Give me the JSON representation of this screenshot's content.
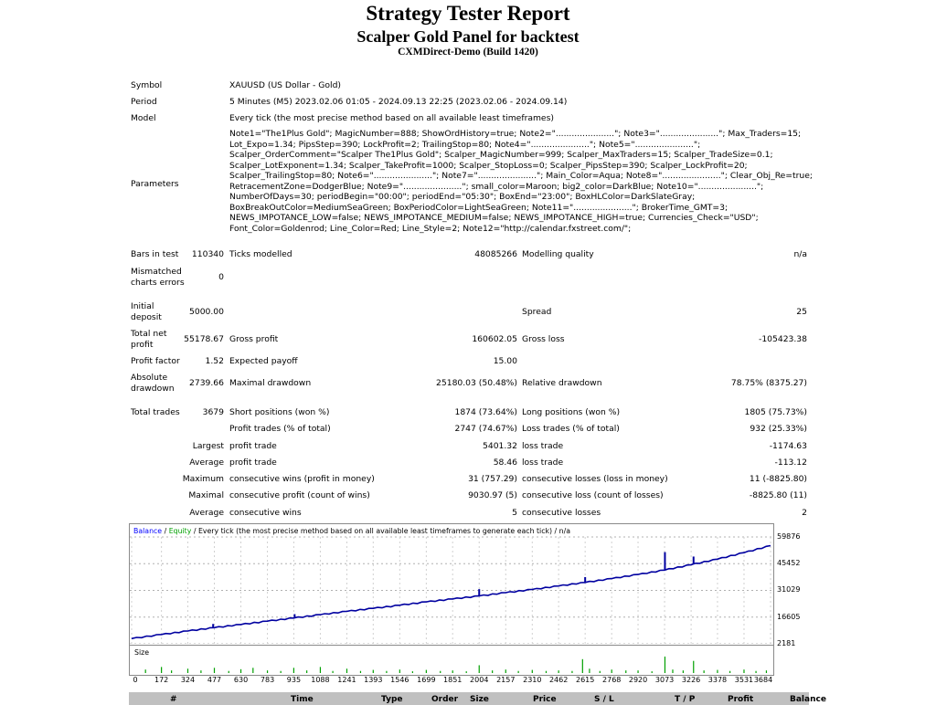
{
  "header": {
    "title": "Strategy Tester Report",
    "subtitle": "Scalper Gold Panel for backtest",
    "server": "CXMDirect-Demo (Build 1420)"
  },
  "info": {
    "symbol_label": "Symbol",
    "symbol_value": "XAUUSD (US Dollar - Gold)",
    "period_label": "Period",
    "period_value": "5 Minutes (M5) 2023.02.06 01:05 - 2024.09.13 22:25 (2023.02.06 - 2024.09.14)",
    "model_label": "Model",
    "model_value": "Every tick (the most precise method based on all available least timeframes)",
    "parameters_label": "Parameters",
    "parameters_value": "Note1=\"The1Plus Gold\"; MagicNumber=888; ShowOrdHistory=true; Note2=\"......................\"; Note3=\"......................\"; Max_Traders=15; Lot_Expo=1.34; PipsStep=390; LockProfit=2; TrailingStop=80; Note4=\"......................\"; Note5=\"......................\"; Scalper_OrderComment=\"Scalper The1Plus Gold\"; Scalper_MagicNumber=999; Scalper_MaxTraders=15; Scalper_TradeSize=0.1; Scalper_LotExponent=1.34; Scalper_TakeProfit=1000; Scalper_StopLoss=0; Scalper_PipsStep=390; Scalper_LockProfit=20; Scalper_TrailingStop=80; Note6=\"......................\"; Note7=\"......................\"; Main_Color=Aqua; Note8=\"......................\"; Clear_Obj_Re=true; RetracementZone=DodgerBlue; Note9=\"......................\"; small_color=Maroon; big2_color=DarkBlue; Note10=\"......................\"; NumberOfDays=30; periodBegin=\"00:00\"; periodEnd=\"05:30\"; BoxEnd=\"23:00\"; BoxHLColor=DarkSlateGray; BoxBreakOutColor=MediumSeaGreen; BoxPeriodColor=LightSeaGreen; Note11=\"......................\"; BrokerTime_GMT=3; NEWS_IMPOTANCE_LOW=false; NEWS_IMPOTANCE_MEDIUM=false; NEWS_IMPOTANCE_HIGH=true; Currencies_Check=\"USD\"; Font_Color=Goldenrod; Line_Color=Red; Line_Style=2; Note12=\"http://calendar.fxstreet.com/\";"
  },
  "stats": {
    "bars_label": "Bars in test",
    "bars_value": "110340",
    "ticks_label": "Ticks modelled",
    "ticks_value": "48085266",
    "quality_label": "Modelling quality",
    "quality_value": "n/a",
    "mismatched_label_1": "Mismatched",
    "mismatched_label_2": "charts errors",
    "mismatched_value": "0",
    "deposit_label_1": "Initial",
    "deposit_label_2": "deposit",
    "deposit_value": "5000.00",
    "spread_label": "Spread",
    "spread_value": "25",
    "net_label_1": "Total net",
    "net_label_2": "profit",
    "net_value": "55178.67",
    "gross_profit_label": "Gross profit",
    "gross_profit_value": "160602.05",
    "gross_loss_label": "Gross loss",
    "gross_loss_value": "-105423.38",
    "pf_label": "Profit factor",
    "pf_value": "1.52",
    "ep_label": "Expected payoff",
    "ep_value": "15.00",
    "abs_dd_label_1": "Absolute",
    "abs_dd_label_2": "drawdown",
    "abs_dd_value": "2739.66",
    "max_dd_label": "Maximal drawdown",
    "max_dd_value": "25180.03 (50.48%)",
    "rel_dd_label": "Relative drawdown",
    "rel_dd_value": "78.75% (8375.27)",
    "trades_label": "Total trades",
    "trades_value": "3679",
    "short_label": "Short positions (won %)",
    "short_value": "1874 (73.64%)",
    "long_label": "Long positions (won %)",
    "long_value": "1805 (75.73%)",
    "profit_trades_label": "Profit trades (% of total)",
    "profit_trades_value": "2747 (74.67%)",
    "loss_trades_label": "Loss trades (% of total)",
    "loss_trades_value": "932 (25.33%)",
    "largest_label": "Largest",
    "largest_pt_label": "profit trade",
    "largest_pt_value": "5401.32",
    "largest_lt_label": "loss trade",
    "largest_lt_value": "-1174.63",
    "average_label": "Average",
    "average_pt_label": "profit trade",
    "average_pt_value": "58.46",
    "average_lt_label": "loss trade",
    "average_lt_value": "-113.12",
    "maximum_label": "Maximum",
    "max_cw_label": "consecutive wins (profit in money)",
    "max_cw_value": "31 (757.29)",
    "max_cl_label": "consecutive losses (loss in money)",
    "max_cl_value": "11 (-8825.80)",
    "maximal_label": "Maximal",
    "maximal_cp_label": "consecutive profit (count of wins)",
    "maximal_cp_value": "9030.97 (5)",
    "maximal_cl_label": "consecutive loss (count of losses)",
    "maximal_cl_value": "-8825.80 (11)",
    "avg2_label": "Average",
    "avg_cw_label": "consecutive wins",
    "avg_cw_value": "5",
    "avg_cl_label": "consecutive losses",
    "avg_cl_value": "2"
  },
  "chart_legend": {
    "balance": "Balance",
    "sep": " / ",
    "equity": "Equity",
    "rest": " / Every tick (the most precise method based on all available least timeframes to generate each tick) / n/a",
    "balance_color": "#0000ff",
    "equity_color": "#00a000",
    "size_label": "Size"
  },
  "chart_data": {
    "type": "line",
    "title": "",
    "xlabel": "",
    "ylabel": "",
    "y_ticks": [
      "59876",
      "45452",
      "31029",
      "16605",
      "2181"
    ],
    "x_ticks": [
      "0",
      "172",
      "324",
      "477",
      "630",
      "783",
      "935",
      "1088",
      "1241",
      "1393",
      "1546",
      "1699",
      "1851",
      "2004",
      "2157",
      "2310",
      "2462",
      "2615",
      "2768",
      "2920",
      "3073",
      "3226",
      "3378",
      "3531",
      "3684"
    ],
    "ylim": [
      2181,
      59876
    ],
    "xlim": [
      0,
      3684
    ],
    "series": [
      {
        "name": "Balance",
        "color": "#0000a0",
        "x": [
          0,
          172,
          324,
          477,
          630,
          783,
          935,
          1088,
          1241,
          1393,
          1546,
          1699,
          1851,
          2004,
          2157,
          2310,
          2462,
          2615,
          2768,
          2920,
          3073,
          3226,
          3378,
          3531,
          3684
        ],
        "y": [
          5000,
          7200,
          9100,
          10900,
          12600,
          14400,
          16100,
          17900,
          19700,
          21300,
          23000,
          24800,
          26400,
          28000,
          29800,
          31500,
          33400,
          35300,
          37400,
          39600,
          42000,
          44900,
          47900,
          51400,
          55178
        ]
      }
    ],
    "spikes": [
      {
        "x": 260,
        "y": 8200
      },
      {
        "x": 470,
        "y": 12900
      },
      {
        "x": 940,
        "y": 18200
      },
      {
        "x": 2004,
        "y": 31700
      },
      {
        "x": 2615,
        "y": 38200
      },
      {
        "x": 3075,
        "y": 51700
      },
      {
        "x": 3240,
        "y": 49300
      }
    ],
    "size_bars": [
      {
        "x": 80,
        "v": 0.2
      },
      {
        "x": 172,
        "v": 0.35
      },
      {
        "x": 230,
        "v": 0.15
      },
      {
        "x": 324,
        "v": 0.25
      },
      {
        "x": 400,
        "v": 0.15
      },
      {
        "x": 477,
        "v": 0.3
      },
      {
        "x": 560,
        "v": 0.12
      },
      {
        "x": 630,
        "v": 0.22
      },
      {
        "x": 700,
        "v": 0.3
      },
      {
        "x": 783,
        "v": 0.15
      },
      {
        "x": 860,
        "v": 0.12
      },
      {
        "x": 935,
        "v": 0.3
      },
      {
        "x": 1010,
        "v": 0.15
      },
      {
        "x": 1088,
        "v": 0.35
      },
      {
        "x": 1160,
        "v": 0.12
      },
      {
        "x": 1241,
        "v": 0.25
      },
      {
        "x": 1320,
        "v": 0.12
      },
      {
        "x": 1393,
        "v": 0.18
      },
      {
        "x": 1470,
        "v": 0.12
      },
      {
        "x": 1546,
        "v": 0.2
      },
      {
        "x": 1620,
        "v": 0.1
      },
      {
        "x": 1699,
        "v": 0.18
      },
      {
        "x": 1780,
        "v": 0.12
      },
      {
        "x": 1851,
        "v": 0.15
      },
      {
        "x": 1930,
        "v": 0.1
      },
      {
        "x": 2004,
        "v": 0.45
      },
      {
        "x": 2080,
        "v": 0.15
      },
      {
        "x": 2157,
        "v": 0.2
      },
      {
        "x": 2230,
        "v": 0.12
      },
      {
        "x": 2310,
        "v": 0.18
      },
      {
        "x": 2390,
        "v": 0.12
      },
      {
        "x": 2462,
        "v": 0.15
      },
      {
        "x": 2540,
        "v": 0.12
      },
      {
        "x": 2600,
        "v": 0.8
      },
      {
        "x": 2640,
        "v": 0.25
      },
      {
        "x": 2700,
        "v": 0.12
      },
      {
        "x": 2768,
        "v": 0.2
      },
      {
        "x": 2850,
        "v": 0.15
      },
      {
        "x": 2920,
        "v": 0.15
      },
      {
        "x": 3000,
        "v": 0.1
      },
      {
        "x": 3075,
        "v": 0.95
      },
      {
        "x": 3120,
        "v": 0.2
      },
      {
        "x": 3180,
        "v": 0.15
      },
      {
        "x": 3240,
        "v": 0.7
      },
      {
        "x": 3300,
        "v": 0.15
      },
      {
        "x": 3378,
        "v": 0.18
      },
      {
        "x": 3450,
        "v": 0.12
      },
      {
        "x": 3531,
        "v": 0.2
      },
      {
        "x": 3600,
        "v": 0.12
      },
      {
        "x": 3660,
        "v": 0.15
      }
    ],
    "grid": true
  },
  "table_header": [
    "#",
    "Time",
    "Type",
    "Order",
    "Size",
    "Price",
    "S / L",
    "T / P",
    "Profit",
    "Balance"
  ]
}
